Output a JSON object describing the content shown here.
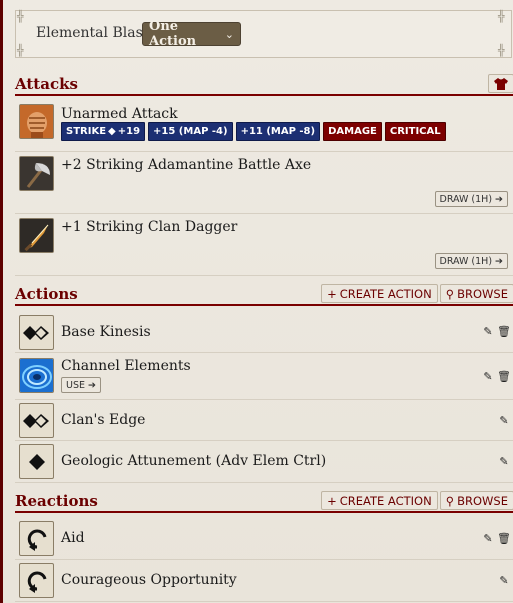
{
  "blast": {
    "label": "Elemental Blast",
    "selected_action": "One Action"
  },
  "attacks": {
    "title": "Attacks",
    "items": [
      {
        "name": "Unarmed Attack",
        "icon": "fist-icon",
        "strike_label": "STRIKE",
        "strike_bonus": "+19",
        "map1": "+15 (MAP -4)",
        "map2": "+11 (MAP -8)",
        "damage": "DAMAGE",
        "critical": "CRITICAL"
      },
      {
        "name": "+2 Striking Adamantine Battle Axe",
        "icon": "battle-axe-icon",
        "draw_label": "DRAW (1H)"
      },
      {
        "name": "+1 Striking Clan Dagger",
        "icon": "dagger-icon",
        "draw_label": "DRAW (1H)"
      }
    ]
  },
  "actions": {
    "title": "Actions",
    "create_label": "CREATE ACTION",
    "browse_label": "BROWSE",
    "items": [
      {
        "name": "Base Kinesis",
        "icon": "two-action-icon",
        "editable": true,
        "deletable": true
      },
      {
        "name": "Channel Elements",
        "icon": "vortex-icon",
        "use_label": "USE",
        "editable": true,
        "deletable": true
      },
      {
        "name": "Clan's Edge",
        "icon": "two-action-icon",
        "editable": true,
        "deletable": false
      },
      {
        "name": "Geologic Attunement (Adv Elem Ctrl)",
        "icon": "one-action-icon",
        "editable": true,
        "deletable": false
      }
    ]
  },
  "reactions": {
    "title": "Reactions",
    "create_label": "CREATE ACTION",
    "browse_label": "BROWSE",
    "items": [
      {
        "name": "Aid",
        "icon": "reaction-icon",
        "editable": true,
        "deletable": true
      },
      {
        "name": "Courageous Opportunity",
        "icon": "reaction-icon",
        "editable": true,
        "deletable": false
      }
    ]
  },
  "colors": {
    "accent": "#6b0000",
    "tag_blue": "#1c2f73",
    "tag_red": "#7d0000",
    "select_bg": "#6b5d45"
  }
}
